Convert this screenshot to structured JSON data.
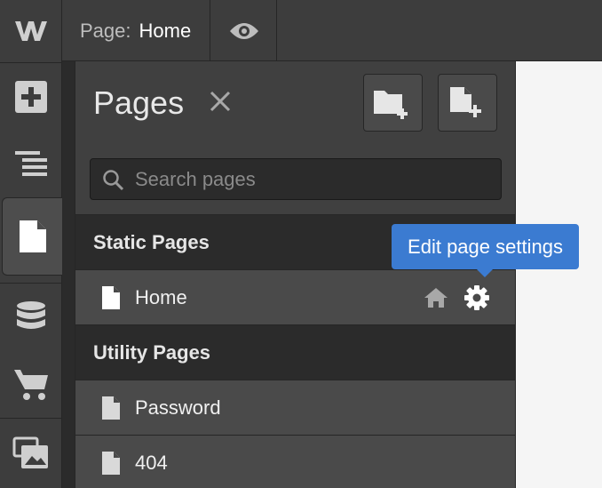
{
  "app": {
    "logo_letter": "W",
    "colors": {
      "accent": "#3b7bd1",
      "panel": "#404040",
      "rail": "#3d3d3d",
      "canvas": "#f5f5f5"
    }
  },
  "rail": {
    "items": [
      {
        "id": "add",
        "icon": "plus-square-icon"
      },
      {
        "id": "navigator",
        "icon": "stacked-lines-icon"
      },
      {
        "id": "pages",
        "icon": "page-icon",
        "active": true
      },
      {
        "id": "cms",
        "icon": "database-icon"
      },
      {
        "id": "ecommerce",
        "icon": "cart-icon"
      },
      {
        "id": "assets",
        "icon": "images-icon"
      }
    ]
  },
  "topbar": {
    "page_key": "Page:",
    "page_value": "Home",
    "preview_icon": "eye-icon"
  },
  "panel": {
    "title": "Pages",
    "close_icon": "close-icon",
    "new_folder_icon": "folder-plus-icon",
    "new_page_icon": "page-plus-icon",
    "search": {
      "placeholder": "Search pages",
      "value": ""
    },
    "sections": [
      {
        "title": "Static Pages",
        "pages": [
          {
            "name": "Home",
            "is_home": true
          }
        ]
      },
      {
        "title": "Utility Pages",
        "pages": [
          {
            "name": "Password"
          },
          {
            "name": "404"
          }
        ]
      }
    ]
  },
  "tooltip": {
    "text": "Edit page settings"
  }
}
